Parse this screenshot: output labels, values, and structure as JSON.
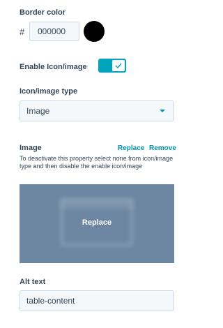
{
  "border_color": {
    "label": "Border color",
    "hash": "#",
    "value": "000000",
    "swatch_color": "#000000"
  },
  "enable_icon": {
    "label": "Enable Icon/image",
    "enabled": true,
    "accent": "#00a4bd",
    "check_icon": "check-icon"
  },
  "icon_type": {
    "label": "Icon/image type",
    "value": "Image",
    "caret_icon": "chevron-down-icon"
  },
  "image": {
    "label": "Image",
    "replace_label": "Replace",
    "remove_label": "Remove",
    "help_text": "To deactivate this property select none from icon/image type and then disable the enable icon/image",
    "preview_label": "Replace",
    "preview_bg": "#6d86a2"
  },
  "alt_text": {
    "label": "Alt text",
    "value": "table-content"
  },
  "colors": {
    "text": "#33475b",
    "link": "#0091ae",
    "input_bg": "#f5f8fa",
    "input_border": "#cbd6e2"
  }
}
